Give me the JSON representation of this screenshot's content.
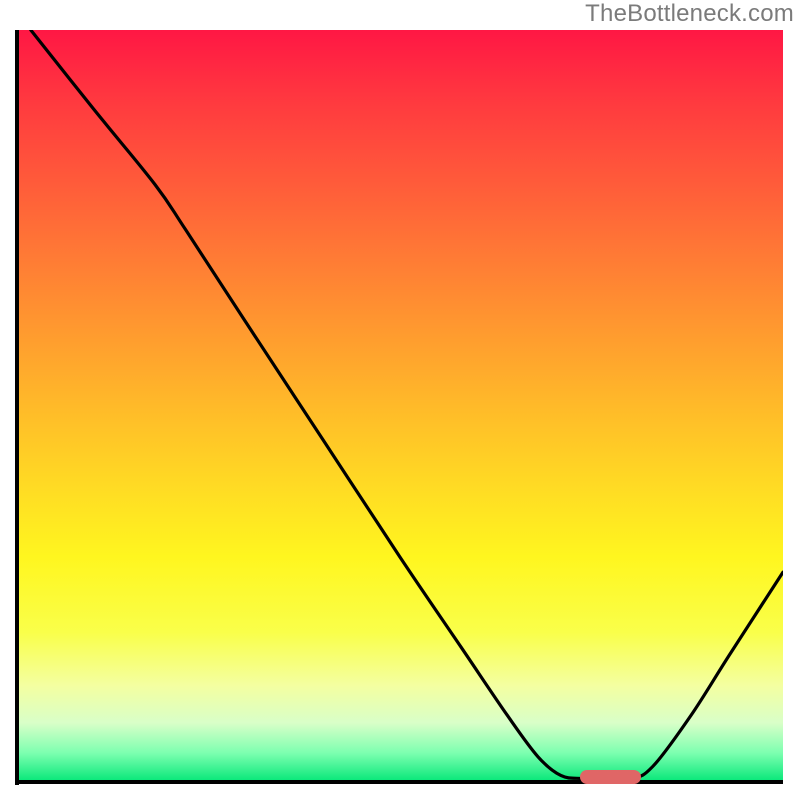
{
  "watermark": "TheBottleneck.com",
  "colors": {
    "curve": "#000000",
    "marker": "#e06666",
    "axis": "#000000"
  },
  "chart_data": {
    "type": "line",
    "title": "",
    "xlabel": "",
    "ylabel": "",
    "xlim": [
      0,
      100
    ],
    "ylim": [
      0,
      100
    ],
    "grid": false,
    "legend": false,
    "curve_points_percent": [
      {
        "x": 1.8,
        "y": 100
      },
      {
        "x": 10,
        "y": 89.5
      },
      {
        "x": 18,
        "y": 79.5
      },
      {
        "x": 22,
        "y": 73.5
      },
      {
        "x": 30,
        "y": 61
      },
      {
        "x": 40,
        "y": 45.5
      },
      {
        "x": 50,
        "y": 30
      },
      {
        "x": 58,
        "y": 18
      },
      {
        "x": 64,
        "y": 9
      },
      {
        "x": 68,
        "y": 3.5
      },
      {
        "x": 71,
        "y": 1.0
      },
      {
        "x": 74,
        "y": 0.6
      },
      {
        "x": 80,
        "y": 0.6
      },
      {
        "x": 83,
        "y": 2.2
      },
      {
        "x": 88,
        "y": 9
      },
      {
        "x": 93,
        "y": 17
      },
      {
        "x": 100,
        "y": 28
      }
    ],
    "marker": {
      "x_start_pct": 73.5,
      "x_end_pct": 81.5,
      "y_pct": 0.55,
      "label": "optimal-range"
    }
  }
}
